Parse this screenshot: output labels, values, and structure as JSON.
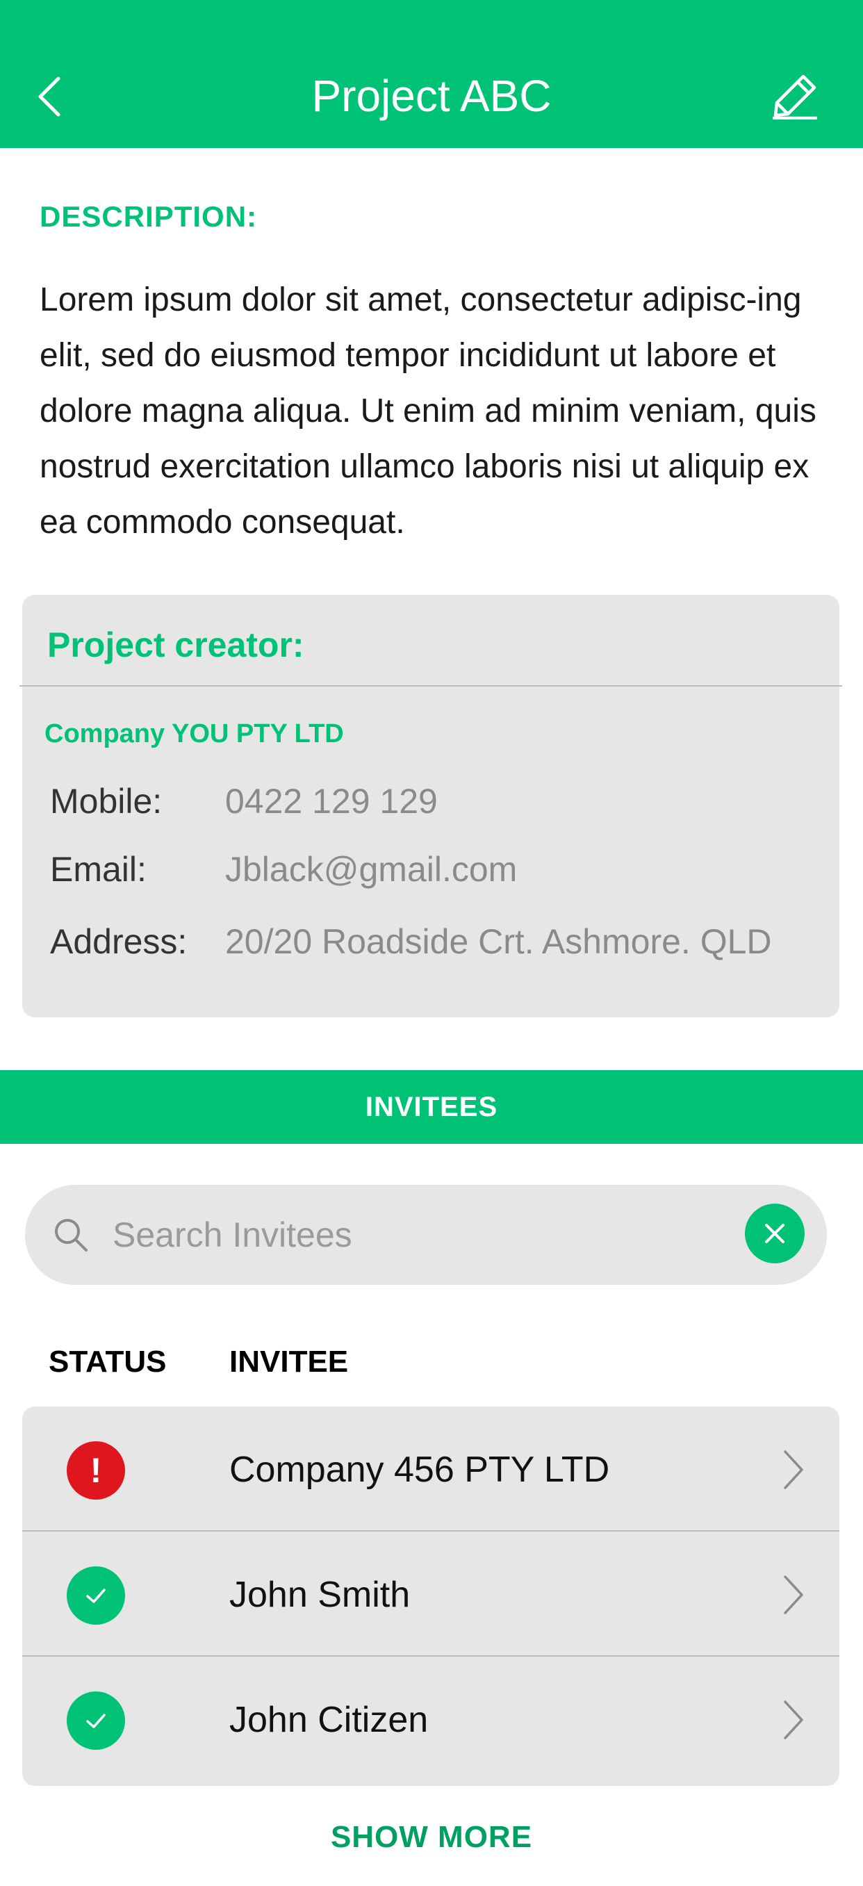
{
  "header": {
    "title": "Project ABC",
    "back_icon": "chevron-left-icon",
    "edit_icon": "pencil-icon"
  },
  "description": {
    "label": "DESCRIPTION:",
    "text": "Lorem ipsum dolor sit amet, consectetur adipisc-ing elit, sed do eiusmod tempor incididunt ut labore et dolore magna aliqua. Ut enim ad minim veniam, quis nostrud exercitation ullamco laboris nisi ut aliquip ex ea commodo consequat."
  },
  "creator": {
    "title": "Project creator:",
    "company": "Company YOU PTY LTD",
    "mobile_label": "Mobile:",
    "mobile": "0422 129 129",
    "email_label": "Email:",
    "email": "Jblack@gmail.com",
    "address_label": "Address:",
    "address": "20/20 Roadside Crt. Ashmore. QLD"
  },
  "invitees": {
    "bar_label": "INVITEES",
    "search_placeholder": "Search Invitees",
    "col_status": "STATUS",
    "col_invitee": "INVITEE",
    "rows": [
      {
        "name": "Company 456 PTY LTD",
        "status": "alert",
        "status_glyph": "!"
      },
      {
        "name": "John Smith",
        "status": "confirmed",
        "status_glyph": "✓"
      },
      {
        "name": "John Citizen",
        "status": "confirmed",
        "status_glyph": "✓"
      }
    ],
    "show_more": "SHOW MORE"
  },
  "colors": {
    "brand_green": "#00c277",
    "alert_red": "#e0161f",
    "card_gray": "#e6e6e6"
  }
}
